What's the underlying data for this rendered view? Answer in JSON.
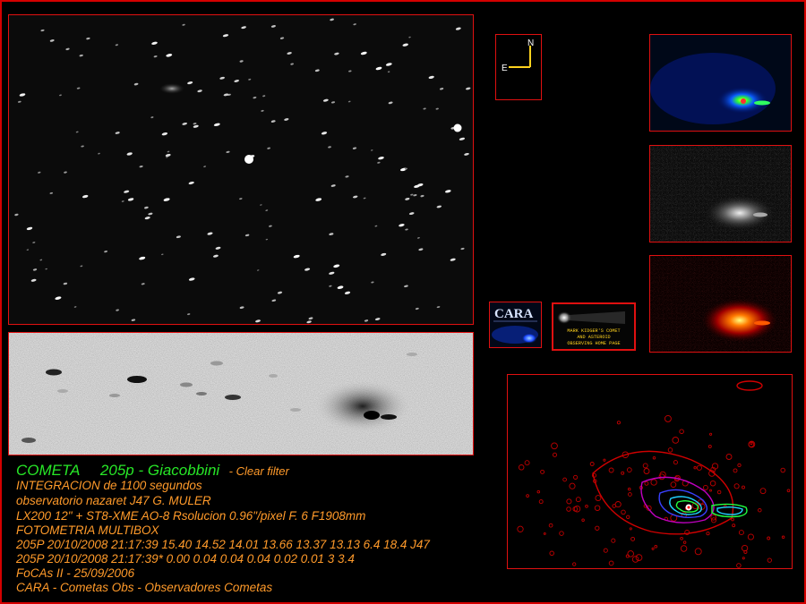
{
  "title": {
    "object_label": "COMETA",
    "comet_name": "205p - Giacobbini",
    "filter": "- Clear filter"
  },
  "info_lines": [
    "INTEGRACION de 1100  segundos",
    "observatorio nazaret J47  G. MULER",
    "LX200 12\" +  ST8-XME AO-8  Rsolucion 0.96\"/pixel   F. 6       F1908mm",
    "FOTOMETRIA MULTIBOX",
    "205P 20/10/2008 21:17:39 15.40 14.52 14.01 13.66 13.37 13.13 6.4 18.4 J47",
    "205P 20/10/2008 21:17:39* 0.00 0.04 0.04 0.04 0.02 0.01 3 3.4",
    "FoCAs II - 25/09/2006",
    "CARA - Cometas Obs - Observadores Cometas"
  ],
  "compass": {
    "north": "N",
    "east": "E"
  },
  "cara_logo": {
    "text": "CARA"
  },
  "kidger_banner": {
    "line1": "MARK KIDGER'S COMET",
    "line2": "AND ASTEROID",
    "line3": "OBSERVING HOME PAGE"
  },
  "colors": {
    "border": "#e01010",
    "green_text": "#27e627",
    "orange_text": "#ff9a2a"
  }
}
